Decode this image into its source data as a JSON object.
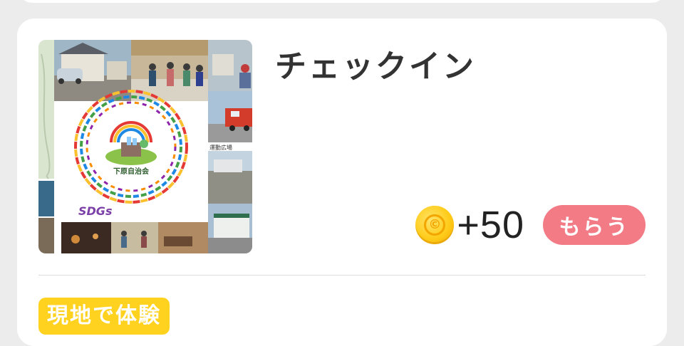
{
  "card": {
    "title": "チェックイン",
    "thumbnail": {
      "center_text": "下原自治会",
      "logo_text": "SDGs",
      "small_label": "運動広場"
    },
    "reward": {
      "icon": "coin-icon",
      "coin_symbol": "©",
      "points": "+50",
      "button_label": "もらう",
      "button_color": "#f27b86",
      "coin_color": "#ffcc1a"
    },
    "tag_label": "現地で体験",
    "tag_color": "#ffd21f"
  }
}
